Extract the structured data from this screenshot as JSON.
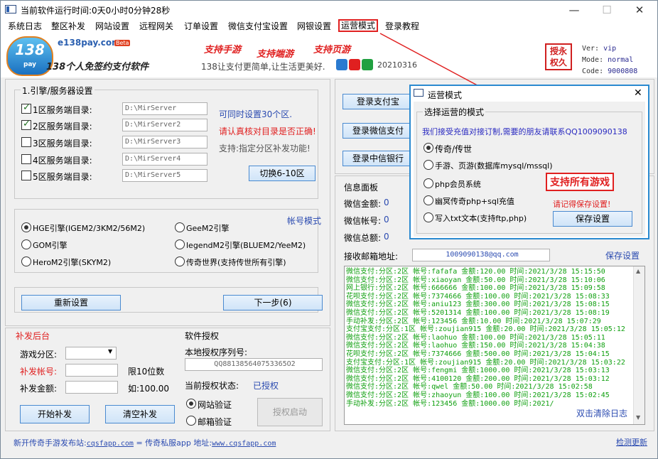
{
  "title": "当前软件运行时间:0天0小时0分钟28秒",
  "window_controls": {
    "minimize": "—",
    "maximize": "☐",
    "close": "✕"
  },
  "menu": [
    "系统日志",
    "整区补发",
    "网站设置",
    "远程网关",
    "订单设置",
    "微信支付宝设置",
    "网银设置",
    "运营模式",
    "登录教程"
  ],
  "header": {
    "logo_text": "138",
    "logo_sub": "pay",
    "brand": "e138pay.com",
    "beta": "Beta",
    "slogan": "138个人免签约支付软件",
    "support": [
      "支持手游",
      "支持端游",
      "支持页游"
    ],
    "tagline": "138让支付更简单,让生活更美好.",
    "date": "20210316",
    "seal": [
      "授",
      "永",
      "权",
      "久"
    ],
    "ver_label": "Ver:",
    "ver": "vip",
    "mode_label": "Mode:",
    "mode": "normal",
    "code_label": "Code:",
    "code": "9000808"
  },
  "engine": {
    "group_title": "1.引擎/服务器设置",
    "servers": [
      {
        "label": "1区服务端目录:",
        "path": "D:\\MirServer",
        "checked": true
      },
      {
        "label": "2区服务端目录:",
        "path": "D:\\MirServer2",
        "checked": true
      },
      {
        "label": "3区服务端目录:",
        "path": "D:\\MirServer3",
        "checked": false
      },
      {
        "label": "4区服务端目录:",
        "path": "D:\\MirServer4",
        "checked": false
      },
      {
        "label": "5区服务端目录:",
        "path": "D:\\MirServer5",
        "checked": false
      }
    ],
    "note1": "可同时设置30个区.",
    "note2": "请认真核对目录是否正确!",
    "note3": "支持:指定分区补发功能!",
    "switch_btn": "切换6-10区"
  },
  "engines": {
    "account_mode": "帐号模式",
    "options": [
      "HGE引擎(IGEM2/3KM2/56M2)",
      "GeeM2引擎",
      "GOM引擎",
      "legendM2引擎(BLUEM2/YeeM2)",
      "HeroM2引擎(SKYM2)",
      "传奇世界(支持传世所有引擎)"
    ]
  },
  "reset_btn": "重新设置",
  "next_btn": "下一步(6)",
  "reissue": {
    "title": "补发后台",
    "zone_label": "游戏分区:",
    "account_label": "补发帐号:",
    "account_hint": "限10位数",
    "amount_label": "补发金额:",
    "amount_hint": "如:100.00",
    "start_btn": "开始补发",
    "clear_btn": "清空补发"
  },
  "license": {
    "title": "软件授权",
    "serial_label": "本地授权序列号:",
    "serial": "QQ881385640753365O2",
    "status_label": "当前授权状态:",
    "status": "已授权",
    "web_verify": "网站验证",
    "mail_verify": "邮箱验证",
    "start_btn": "授权启动"
  },
  "login_buttons": [
    "登录支付宝",
    "登录微信支付",
    "登录中信银行"
  ],
  "info": {
    "title": "信息面板",
    "wx_amount_label": "微信金额:",
    "wx_amount": "0",
    "wx_account_label": "微信帐号:",
    "wx_account": "0",
    "wx_total_label": "微信总额:",
    "wx_total": "0",
    "email_label": "接收邮箱地址:",
    "email": "1009090138@qq.com",
    "save_btn": "保存设置"
  },
  "log": [
    "微信支付:分区:2区 帐号:fafafa 金额:120.00 时间:2021/3/28 15:15:50",
    "微信支付:分区:2区 帐号:xiaoyan 金额:50.00 时间:2021/3/28 15:10:06",
    "网上银行:分区:2区 帐号:666666 金额:100.00 时间:2021/3/28 15:09:58",
    "花呗支付:分区:2区 帐号:7374666 金额:100.00 时间:2021/3/28 15:08:33",
    "微信支付:分区:2区 帐号:aniu123 金额:300.00 时间:2021/3/28 15:08:15",
    "微信支付:分区:2区 帐号:5201314 金额:100.00 时间:2021/3/28 15:08:19",
    "手动补发:分区:2区 帐号:123456 金额:10.00 时间:2021/3/28 15:07:29",
    "支付宝支付:分区:1区 帐号:zoujian915 金额:20.00 时间:2021/3/28 15:05:12",
    "微信支付:分区:2区 帐号:laohuo 金额:100.00 时间:2021/3/28 15:05:11",
    "微信支付:分区:2区 帐号:laohuo 金额:150.00 时间:2021/3/28 15:04:38",
    "花呗支付:分区:2区 帐号:7374666 金额:500.00 时间:2021/3/28 15:04:15",
    "支付宝支付:分区:1区 帐号:zoujian915 金额:20.00 时间:2021/3/28 15:03:22",
    "微信支付:分区:2区 帐号:fengmi 金额:1000.00 时间:2021/3/28 15:03:13",
    "微信支付:分区:2区 帐号:4100120 金额:200.00 时间:2021/3/28 15:03:12",
    "微信支付:分区:2区 帐号:qwel 金额:50.00 时间:2021/3/28 15:02:58",
    "微信支付:分区:2区 帐号:zhaoyun 金额:100.00 时间:2021/3/28 15:02:45",
    "手动补发:分区:2区 帐号:123456 金额:1000.00 时间:2021/"
  ],
  "clear_log": "双击清除日志",
  "footer": {
    "text": "新开传奇手游发布站:",
    "site1": "cqsfapp.com",
    "middle": " = 传奇私服app 地址:",
    "site2": "www.cqsfapp.com",
    "update": "检测更新"
  },
  "dialog": {
    "title": "运营模式",
    "close": "✕",
    "group": "选择运营的模式",
    "notice": "我们接受充值对接订制,需要的朋友请联系QQ1009090138",
    "options": [
      "传奇/传世",
      "手游、页游(数据库mysql/mssql)",
      "php会员系统",
      "幽冥传奇php+sql充值",
      "写入txt文本(支持ftp,php)"
    ],
    "badge": "支持所有游戏",
    "save_hint": "请记得保存设置!",
    "save_btn": "保存设置"
  },
  "colors": {
    "accent": "#2a4ab0",
    "alert": "#e02020",
    "log_green": "#10a010"
  }
}
